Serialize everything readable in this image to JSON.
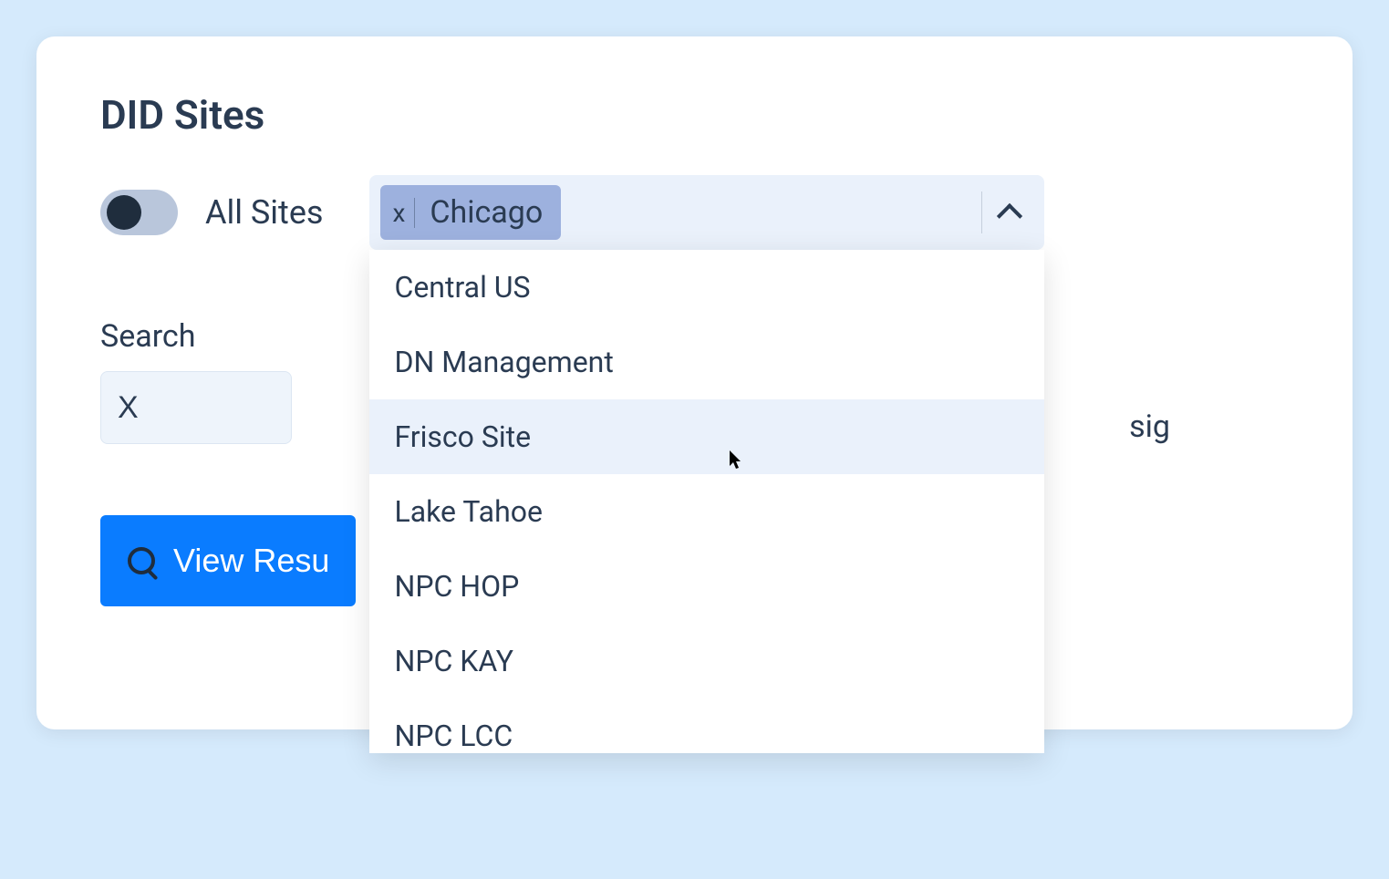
{
  "title": "DID Sites",
  "toggle": {
    "label": "All Sites",
    "on": false
  },
  "siteSelect": {
    "selected": [
      "Chicago"
    ],
    "chipClose": "x",
    "options": [
      {
        "label": "Central US",
        "highlight": false
      },
      {
        "label": "DN Management",
        "highlight": false
      },
      {
        "label": "Frisco Site",
        "highlight": true
      },
      {
        "label": "Lake Tahoe",
        "highlight": false
      },
      {
        "label": "NPC HOP",
        "highlight": false
      },
      {
        "label": "NPC KAY",
        "highlight": false
      },
      {
        "label": "NPC LCC",
        "highlight": false
      }
    ]
  },
  "search": {
    "label": "Search",
    "value": "X"
  },
  "partialText": "sig",
  "viewButton": "View Resu"
}
